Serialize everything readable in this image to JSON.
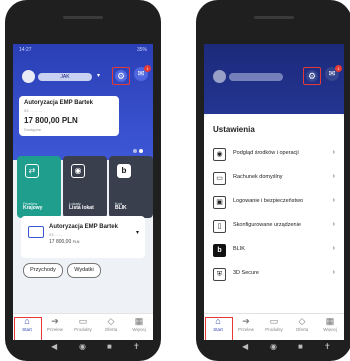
{
  "left": {
    "status": {
      "left": "14:27",
      "right": "35%"
    },
    "user": {
      "name": "JAK"
    },
    "icons": {
      "settings": "gear-icon",
      "notifications": "gift-icon"
    },
    "notif_count": "1",
    "account_card": {
      "title": "Autoryzacja EMP Bartek",
      "number": "03 ... ... ...",
      "balance": "17 800,00 PLN",
      "sub": "Dostępne"
    },
    "tiles": [
      {
        "label": "Przelew",
        "sub": "Krajowy",
        "icon": "transfer-icon",
        "color": "#1f9e8e"
      },
      {
        "label": "Lokaty",
        "sub": "Lista lokat",
        "icon": "deposit-icon",
        "color": "#3a3f4d"
      },
      {
        "label": "Kod",
        "sub": "BLIK",
        "icon": "blik-icon",
        "color": "#3a3f4d"
      }
    ],
    "account_section": {
      "title": "Autoryzacja EMP Bartek",
      "number": "03 ... ...",
      "balance": "17 800,00",
      "currency": "PLN"
    },
    "pills": [
      "Przychody",
      "Wydatki"
    ],
    "nav": [
      {
        "label": "Start",
        "icon": "home-icon"
      },
      {
        "label": "Przelew",
        "icon": "transfer-icon"
      },
      {
        "label": "Produkty",
        "icon": "wallet-icon"
      },
      {
        "label": "Oferta",
        "icon": "tag-icon"
      },
      {
        "label": "Więcej",
        "icon": "grid-icon"
      }
    ]
  },
  "right": {
    "sheet_title": "Ustawienia",
    "menu": [
      {
        "label": "Podgląd środków i operacji",
        "icon": "eye-icon"
      },
      {
        "label": "Rachunek domyślny",
        "icon": "wallet-icon"
      },
      {
        "label": "Logowanie i bezpieczeństwo",
        "icon": "lock-icon"
      },
      {
        "label": "Skonfigurowane urządzenie",
        "icon": "phone-icon"
      },
      {
        "label": "BLIK",
        "icon": "blik-icon"
      },
      {
        "label": "3D Secure",
        "icon": "shield-icon"
      }
    ],
    "nav": [
      {
        "label": "Start",
        "icon": "home-icon"
      },
      {
        "label": "Przelew",
        "icon": "transfer-icon"
      },
      {
        "label": "Produkty",
        "icon": "wallet-icon"
      },
      {
        "label": "Oferta",
        "icon": "tag-icon"
      },
      {
        "label": "Więcej",
        "icon": "grid-icon"
      }
    ]
  }
}
